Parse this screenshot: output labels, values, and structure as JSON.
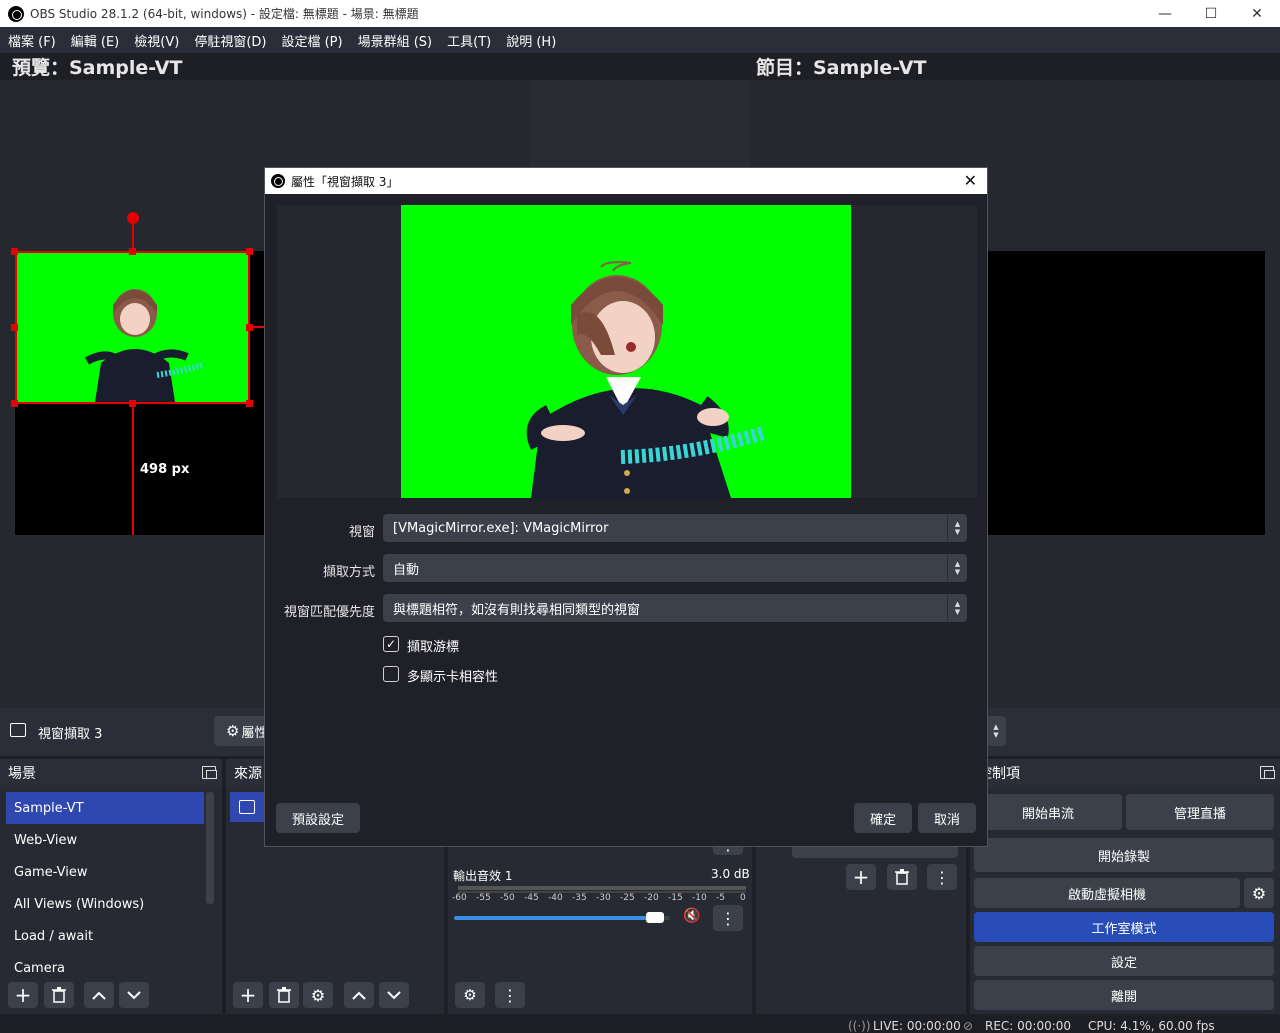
{
  "titlebar": {
    "title": "OBS Studio 28.1.2 (64-bit, windows) - 設定檔: 無標題 - 場景: 無標題",
    "minimize": "—",
    "maximize": "☐",
    "close": "✕"
  },
  "menu": [
    "檔案 (F)",
    "編輯 (E)",
    "檢視(V)",
    "停駐視窗(D)",
    "設定檔 (P)",
    "場景群組 (S)",
    "工具(T)",
    "說明 (H)"
  ],
  "preview": {
    "label": "預覽：Sample-VT",
    "dimension": "498 px"
  },
  "program": {
    "label": "節目：Sample-VT"
  },
  "source_toolbar": {
    "selected_source": "視窗擷取 3",
    "properties_label": "屬性"
  },
  "scenes": {
    "header": "場景",
    "items": [
      "Sample-VT",
      "Web-View",
      "Game-View",
      "All Views (Windows)",
      "Load / await",
      "Camera"
    ],
    "selected": "Sample-VT"
  },
  "sources": {
    "header": "來源"
  },
  "mixer": {
    "channel_name": "輸出音效 1",
    "level": "3.0 dB",
    "ticks": [
      "-60",
      "-55",
      "-50",
      "-45",
      "-40",
      "-35",
      "-30",
      "-25",
      "-20",
      "-15",
      "-10",
      "-5",
      "0"
    ],
    "volume": 0.93
  },
  "controls": {
    "header": "控制項",
    "start_stream": "開始串流",
    "manage_broadcast": "管理直播",
    "start_recording": "開始錄製",
    "start_virtualcam": "啟動虛擬相機",
    "studio_mode": "工作室模式",
    "settings": "設定",
    "exit": "離開"
  },
  "status": {
    "live": "LIVE: 00:00:00",
    "rec": "REC: 00:00:00",
    "cpu": "CPU: 4.1%, 60.00 fps"
  },
  "dialog": {
    "title": "屬性「視窗擷取 3」",
    "window_label": "視窗",
    "window_value": "[VMagicMirror.exe]: VMagicMirror",
    "capture_method_label": "擷取方式",
    "capture_method_value": "自動",
    "priority_label": "視窗匹配優先度",
    "priority_value": "與標題相符，如沒有則找尋相同類型的視窗",
    "capture_cursor_label": "擷取游標",
    "capture_cursor_checked": true,
    "multi_adapter_label": "多顯示卡相容性",
    "multi_adapter_checked": false,
    "defaults_button": "預設設定",
    "ok_button": "確定",
    "cancel_button": "取消"
  },
  "colors": {
    "accent": "#2f48b0",
    "chroma_green": "#00ff00",
    "selection_red": "#e60000"
  }
}
